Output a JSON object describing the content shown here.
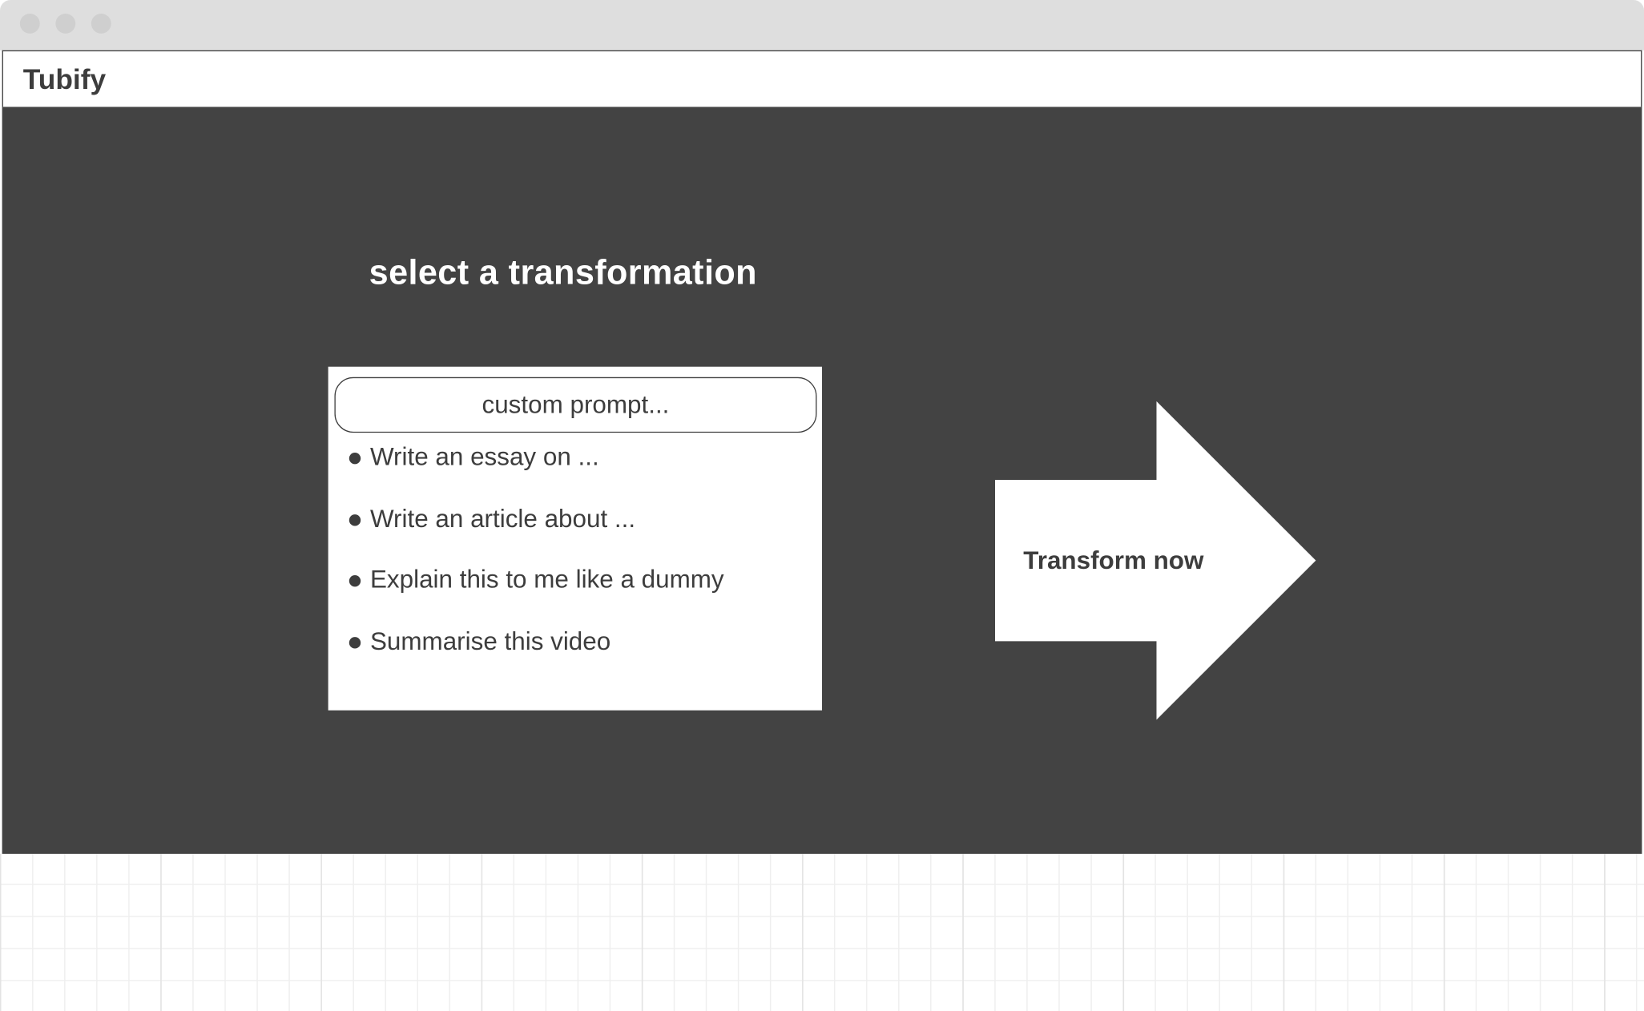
{
  "app": {
    "name": "Tubify"
  },
  "main": {
    "heading": "select a transformation",
    "prompt": {
      "placeholder": "custom prompt..."
    },
    "options": [
      "Write an essay on ...",
      "Write an article about ...",
      "Explain this to me like a dummy",
      "Summarise this video"
    ],
    "action_label": "Transform now"
  },
  "colors": {
    "background_dark": "#434343",
    "text": "#3d3d3d",
    "surface": "#ffffff"
  }
}
